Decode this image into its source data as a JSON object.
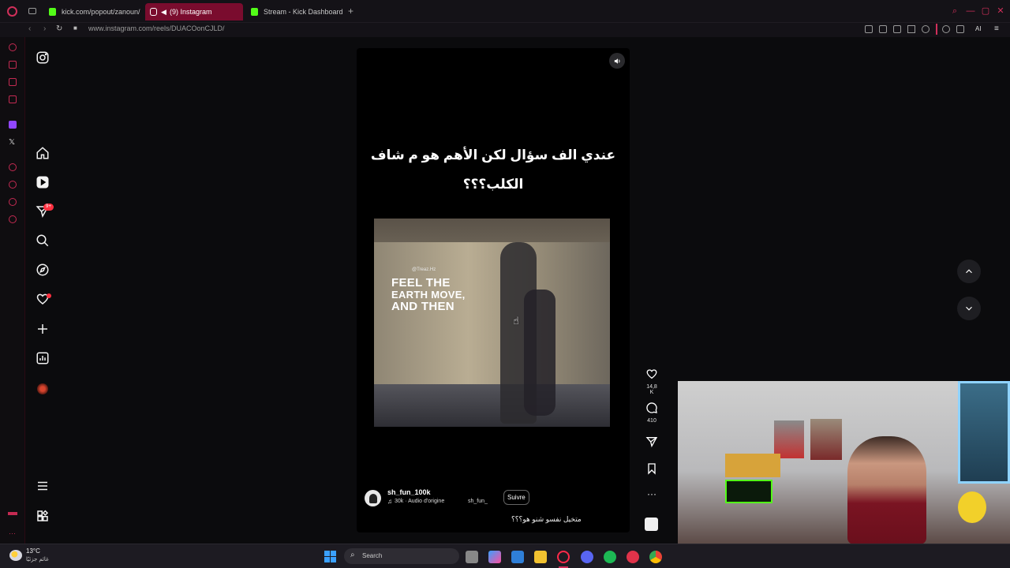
{
  "browser": {
    "tabs": [
      {
        "label": "kick.com/popout/zanoun/",
        "favicon_color": "#53fc18",
        "active": false
      },
      {
        "label": "(9) Instagram",
        "favicon_color": "#ffffff",
        "active": true
      },
      {
        "label": "Stream - Kick Dashboard",
        "favicon_color": "#53fc18",
        "active": false
      }
    ],
    "new_tab": "+",
    "url": "www.instagram.com/reels/DUACOonCJLD/",
    "toolbar_ai": "AI"
  },
  "instagram": {
    "nav": {
      "notifications_badge": "9+"
    },
    "reel": {
      "caption_line1": "عندي الف سؤال لكن الأهم هو م شاف",
      "caption_line2": "الكلب؟؟؟",
      "video_watermark": "@Treaz.Hz",
      "video_text_line1": "FEEL THE",
      "video_text_line2": "EARTH MOVE,",
      "video_text_line3": "AND THEN",
      "username": "sh_fun_100k",
      "audio": "30k · Audio d'origine",
      "audio_tag": "sh_fun_",
      "follow_label": "Suivre",
      "description": "متخيل نفسو شنو هو؟؟؟",
      "likes": "14,8 K",
      "comments": "410"
    }
  },
  "taskbar": {
    "weather_temp": "13°C",
    "weather_desc": "غائم جزئيًا",
    "search_label": "Search"
  },
  "colors": {
    "accent": "#d02f5a",
    "ig_badge": "#ff3040",
    "kick_green": "#53fc18"
  }
}
